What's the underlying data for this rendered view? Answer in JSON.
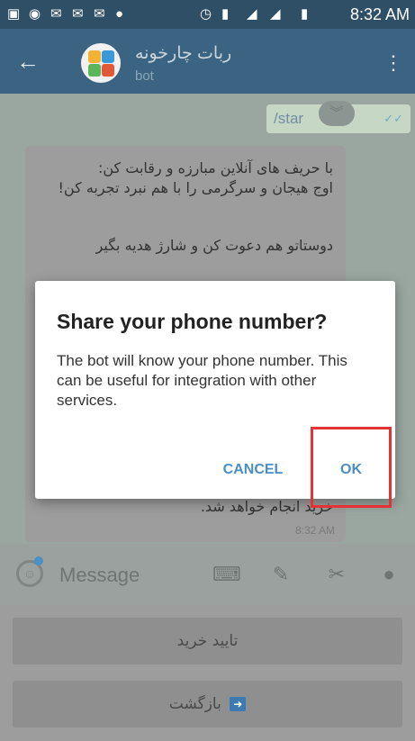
{
  "status_bar": {
    "time": "8:32 AM",
    "icons": [
      "gallery-icon",
      "whatsapp-icon",
      "mail-icon",
      "mail-icon",
      "mail-icon",
      "notification-icon",
      "alarm-icon",
      "4g-icon",
      "signal-icon",
      "signal-icon",
      "battery-icon"
    ]
  },
  "app_bar": {
    "title": "ربات چارخونه",
    "subtitle": "bot"
  },
  "chat": {
    "outgoing": {
      "text": "/star"
    },
    "incoming": {
      "lines": [
        "با حریف های آنلاین مبارزه و رقابت کن:",
        "اوج هیجان و سرگرمی را با هم نبرد تجربه کن!",
        "دوستاتو هم دعوت کن و شارژ هدیه بگیر",
        "خرید انجام خواهد شد."
      ],
      "time": "8:32 AM"
    }
  },
  "dialog": {
    "title": "Share your phone number?",
    "body": "The bot will know your phone number. This can be useful for integration with other services.",
    "cancel_label": "CANCEL",
    "ok_label": "OK"
  },
  "input_bar": {
    "placeholder": "Message"
  },
  "keyboard": {
    "buttons": [
      "تایید خرید",
      "بازگشت"
    ]
  },
  "colors": {
    "status_bar": "#2f4f66",
    "app_bar": "#3a6481",
    "dialog_accent": "#4a8ec4",
    "highlight": "#e53333"
  }
}
